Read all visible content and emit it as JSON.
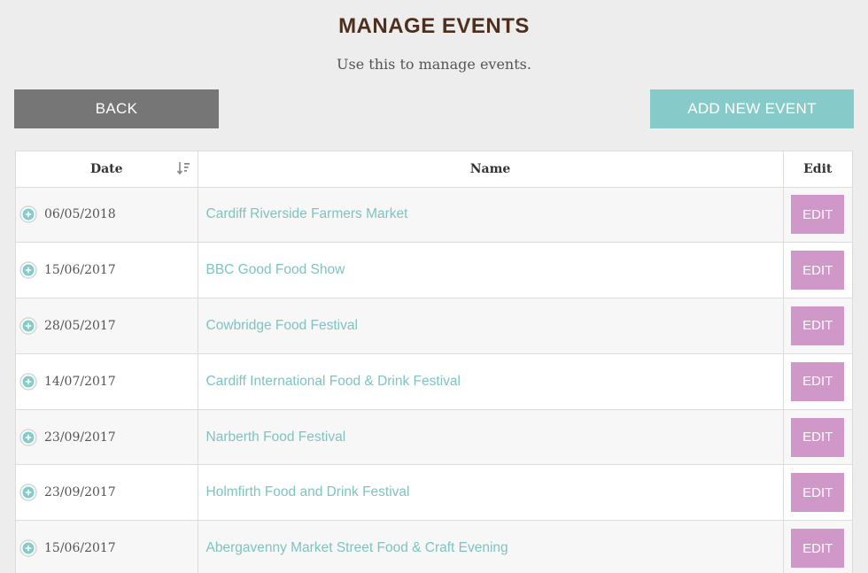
{
  "header": {
    "title": "MANAGE EVENTS",
    "subtitle": "Use this to manage events."
  },
  "actions": {
    "back_label": "BACK",
    "add_label": "ADD NEW EVENT"
  },
  "table": {
    "columns": {
      "date": "Date",
      "name": "Name",
      "edit": "Edit"
    },
    "edit_label": "EDIT",
    "rows": [
      {
        "date": "06/05/2018",
        "name": "Cardiff Riverside Farmers Market"
      },
      {
        "date": "15/06/2017",
        "name": "BBC Good Food Show"
      },
      {
        "date": "28/05/2017",
        "name": "Cowbridge Food Festival"
      },
      {
        "date": "14/07/2017",
        "name": "Cardiff International Food & Drink Festival"
      },
      {
        "date": "23/09/2017",
        "name": "Narberth Food Festival"
      },
      {
        "date": "23/09/2017",
        "name": "Holmfirth Food and Drink Festival"
      },
      {
        "date": "15/06/2017",
        "name": "Abergavenny Market Street Food & Craft Evening"
      }
    ]
  },
  "colors": {
    "title": "#4e2f1c",
    "back_button": "#767676",
    "add_button": "#86cbc9",
    "link": "#7fc3c1",
    "edit_button": "#cf98c9"
  },
  "icons": {
    "sort": "sort-descending-icon",
    "expand": "expand-plus-icon"
  }
}
